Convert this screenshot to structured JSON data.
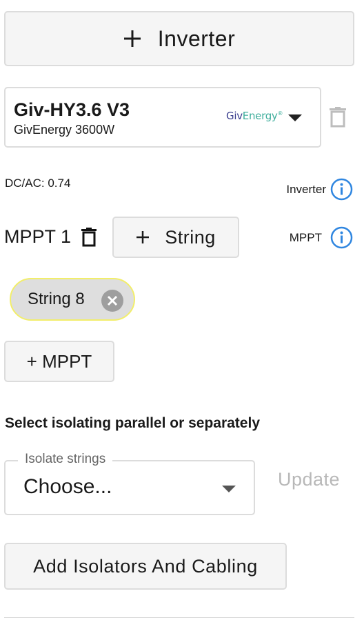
{
  "add_inverter_label": "Inverter",
  "inverter": {
    "model": "Giv-HY3.6 V3",
    "subtitle": "GivEnergy 3600W",
    "brand_logo_text": "GivEnergy",
    "brand_colors": [
      "#3b3f8f",
      "#3fae9c"
    ]
  },
  "dc_ac": "DC/AC: 0.74",
  "inverter_info_label": "Inverter",
  "mppt": {
    "name": "MPPT 1",
    "add_string_label": "String",
    "info_label": "MPPT",
    "strings": [
      {
        "label": "String 8"
      }
    ]
  },
  "add_mppt_label": "+ MPPT",
  "isolation": {
    "heading": "Select isolating parallel or separately",
    "select_legend": "Isolate strings",
    "select_value": "Choose...",
    "update_label": "Update"
  },
  "add_isolators_label": "Add Isolators And Cabling",
  "colors": {
    "info_blue": "#2f86e0",
    "chip_border": "#f2ee6a",
    "disabled_text": "#b8b8b8"
  }
}
